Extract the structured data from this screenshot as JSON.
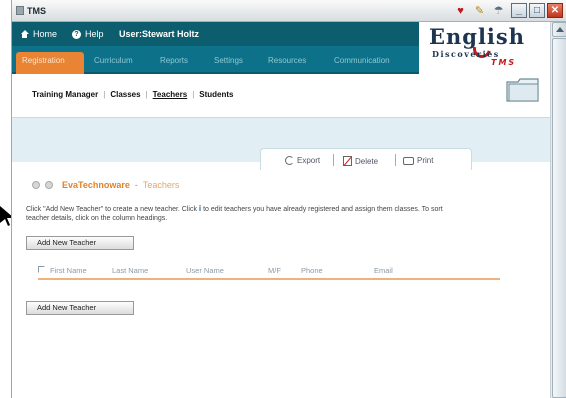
{
  "window": {
    "title": "TMS",
    "minimize": "_",
    "maximize": "□",
    "close": "✕"
  },
  "header": {
    "home": "Home",
    "help": "Help",
    "user": "User:Stewart Holtz"
  },
  "logo": {
    "line1": "English",
    "line2": "Discoveries",
    "line3": "TMS"
  },
  "nav": {
    "tabs": [
      "Registration",
      "Curriculum",
      "Reports",
      "Settings",
      "Resources",
      "Communication"
    ],
    "active": "Registration"
  },
  "subnav": {
    "links": [
      "Training Manager",
      "Classes",
      "Teachers",
      "Students"
    ],
    "active": "Teachers"
  },
  "toolbar": {
    "export": "Export",
    "delete": "Delete",
    "print": "Print"
  },
  "content": {
    "org": "EvaTechnoware",
    "dash": " - ",
    "section": "Teachers",
    "instructions_a": "Click \"Add New Teacher\" to create a new teacher. Click ",
    "instructions_b": " to edit teachers you have already registered and assign them classes. To sort teacher details, click on the column headings.",
    "add_button": "Add New Teacher",
    "columns": [
      "First Name",
      "Last Name",
      "User Name",
      "M/F",
      "Phone",
      "Email"
    ]
  }
}
